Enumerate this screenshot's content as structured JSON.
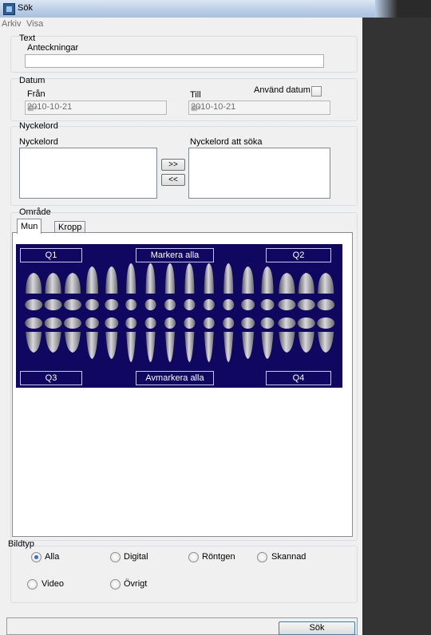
{
  "window": {
    "title": "Sök"
  },
  "menu": {
    "file": "Arkiv",
    "view": "Visa"
  },
  "text_group": {
    "title": "Text",
    "notes_label": "Anteckningar",
    "notes_value": ""
  },
  "date_group": {
    "title": "Datum",
    "from_label": "Från",
    "to_label": "Till",
    "from_value": "2010-10-21",
    "to_value": "2010-10-21",
    "use_date_label": "Använd datum",
    "use_date_checked": false
  },
  "keyword_group": {
    "title": "Nyckelord",
    "available_label": "Nyckelord",
    "selected_label": "Nyckelord att söka",
    "add_button": ">>",
    "remove_button": "<<"
  },
  "area_group": {
    "title": "Område",
    "tabs": [
      {
        "label": "Mun",
        "selected": true
      },
      {
        "label": "Kropp",
        "selected": false
      }
    ],
    "q1": "Q1",
    "q2": "Q2",
    "q3": "Q3",
    "q4": "Q4",
    "select_all": "Markera alla",
    "deselect_all": "Avmarkera alla"
  },
  "image_type_group": {
    "title": "Bildtyp",
    "options": [
      {
        "label": "Alla",
        "selected": true
      },
      {
        "label": "Digital",
        "selected": false
      },
      {
        "label": "Röntgen",
        "selected": false
      },
      {
        "label": "Skannad",
        "selected": false
      },
      {
        "label": "Video",
        "selected": false
      },
      {
        "label": "Övrigt",
        "selected": false
      }
    ]
  },
  "search_button": "Sök",
  "colors": {
    "tooth_panel_bg": "#0f0760",
    "right_pane_bg": "#333333"
  }
}
